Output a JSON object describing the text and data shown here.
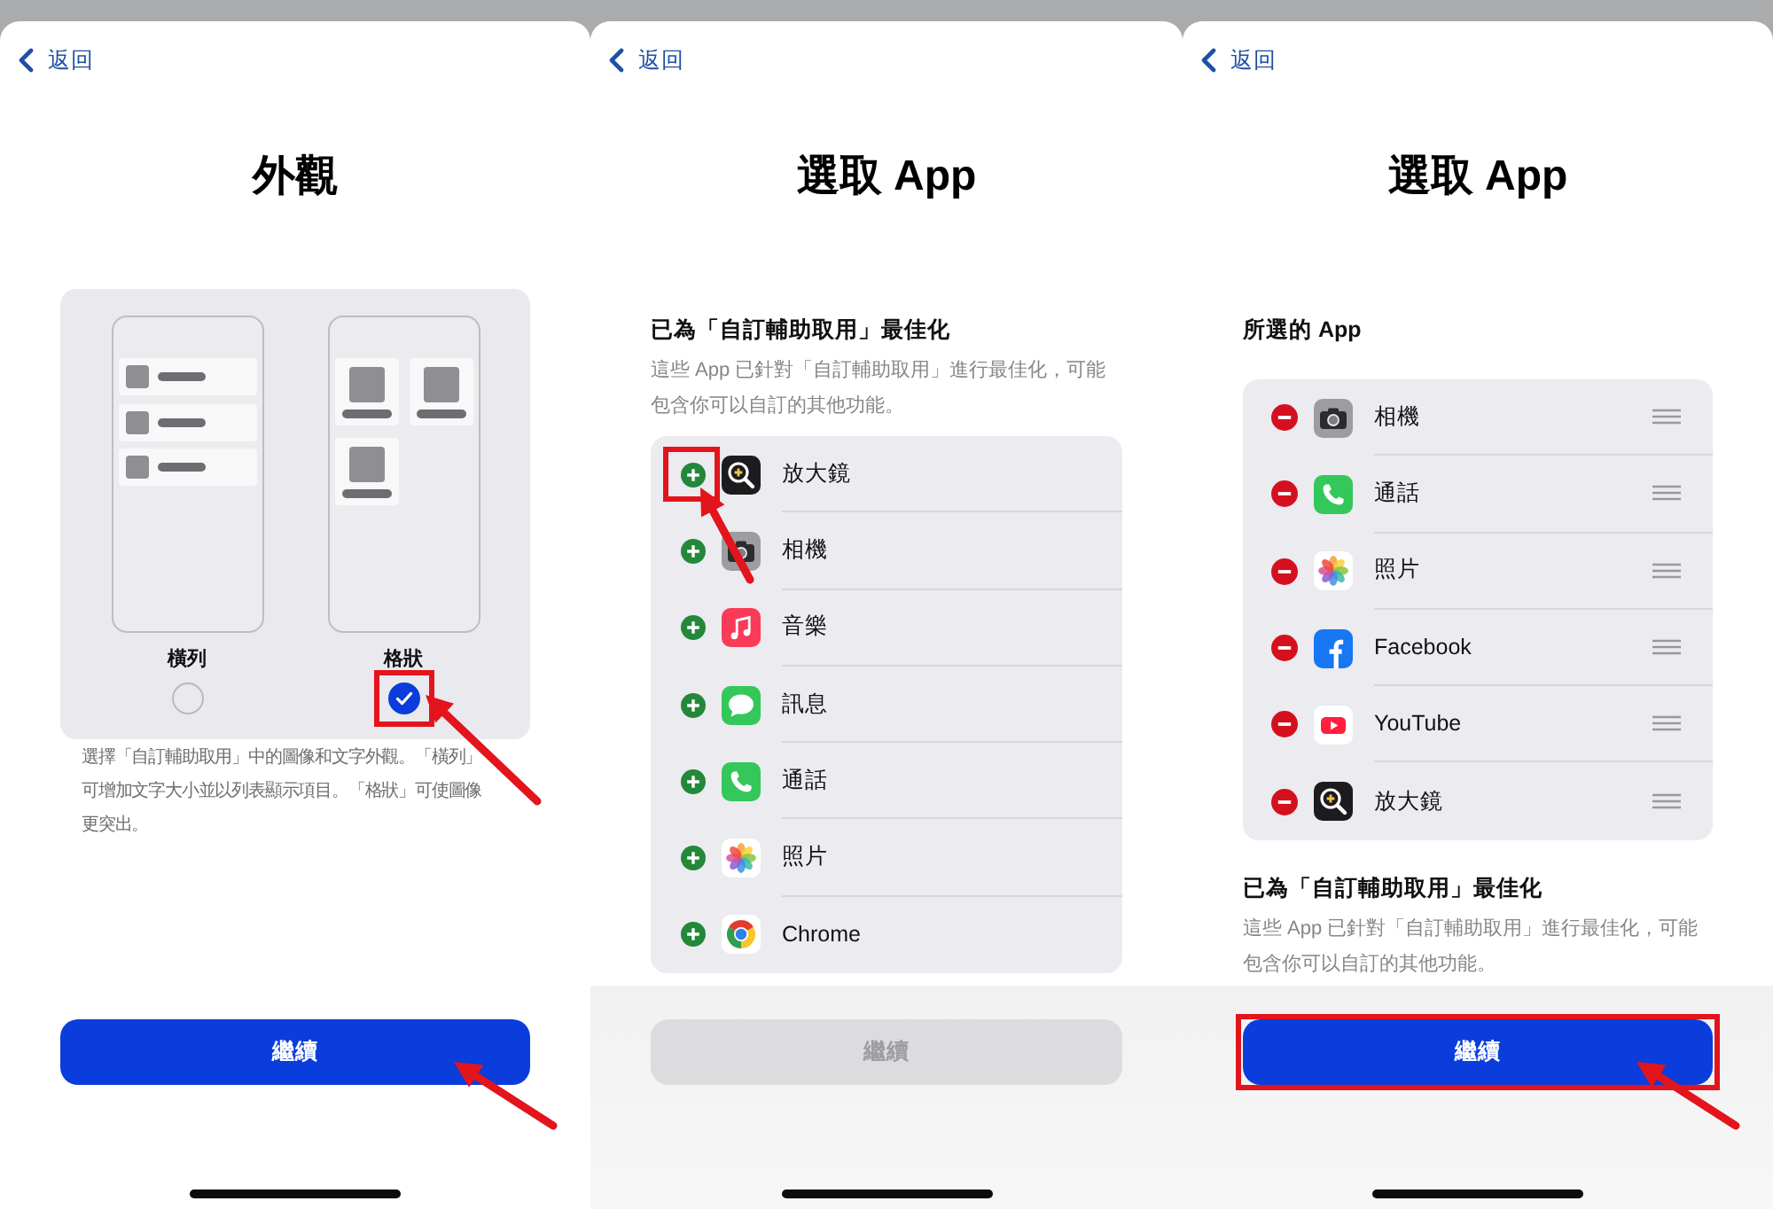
{
  "panels": [
    {
      "back_label": "返回",
      "title": "外觀",
      "blocks": [
        {
          "kind": "layout_picker",
          "options": [
            {
              "kind": "list",
              "label": "橫列",
              "selected": false,
              "highlighted": false,
              "arrow": false
            },
            {
              "kind": "grid",
              "label": "格狀",
              "selected": true,
              "highlighted": true,
              "arrow": true
            }
          ]
        },
        {
          "kind": "note",
          "text": "選擇「自訂輔助取用」中的圖像和文字外觀。「橫列」可增加文字大小並以列表顯示項目。「格狀」可使圖像更突出。"
        }
      ],
      "footer_blurred": false,
      "continue_button": {
        "label": "繼續",
        "disabled": false,
        "highlighted": false,
        "arrow": true
      }
    },
    {
      "back_label": "返回",
      "title": "選取 App",
      "blocks": [
        {
          "kind": "section",
          "heading": "已為「自訂輔助取用」最佳化",
          "description": "這些 App 已針對「自訂輔助取用」進行最佳化，可能包含你可以自訂的其他功能。",
          "reorderable": false,
          "apps": [
            {
              "kind": "magnifier",
              "name": "放大鏡",
              "included": false,
              "highlighted": true,
              "arrow": true
            },
            {
              "kind": "camera",
              "name": "相機",
              "included": false,
              "highlighted": false,
              "arrow": false
            },
            {
              "kind": "music",
              "name": "音樂",
              "included": false,
              "highlighted": false,
              "arrow": false
            },
            {
              "kind": "messages",
              "name": "訊息",
              "included": false,
              "highlighted": false,
              "arrow": false
            },
            {
              "kind": "phone",
              "name": "通話",
              "included": false,
              "highlighted": false,
              "arrow": false
            },
            {
              "kind": "photos",
              "name": "照片",
              "included": false,
              "highlighted": false,
              "arrow": false
            },
            {
              "kind": "chrome",
              "name": "Chrome",
              "included": false,
              "highlighted": false,
              "arrow": false
            }
          ]
        }
      ],
      "footer_blurred": true,
      "continue_button": {
        "label": "繼續",
        "disabled": true,
        "highlighted": false,
        "arrow": false
      }
    },
    {
      "back_label": "返回",
      "title": "選取 App",
      "blocks": [
        {
          "kind": "section",
          "heading": "所選的 App",
          "reorderable": true,
          "apps": [
            {
              "kind": "camera",
              "name": "相機",
              "included": true,
              "highlighted": false,
              "arrow": false
            },
            {
              "kind": "phone",
              "name": "通話",
              "included": true,
              "highlighted": false,
              "arrow": false
            },
            {
              "kind": "photos",
              "name": "照片",
              "included": true,
              "highlighted": false,
              "arrow": false
            },
            {
              "kind": "facebook",
              "name": "Facebook",
              "included": true,
              "highlighted": false,
              "arrow": false
            },
            {
              "kind": "youtube",
              "name": "YouTube",
              "included": true,
              "highlighted": false,
              "arrow": false
            },
            {
              "kind": "magnifier",
              "name": "放大鏡",
              "included": true,
              "highlighted": false,
              "arrow": false
            }
          ]
        },
        {
          "kind": "section",
          "heading": "已為「自訂輔助取用」最佳化",
          "description": "這些 App 已針對「自訂輔助取用」進行最佳化，可能包含你可以自訂的其他功能。"
        }
      ],
      "footer_blurred": true,
      "continue_button": {
        "label": "繼續",
        "disabled": false,
        "highlighted": true,
        "arrow": true
      }
    }
  ]
}
